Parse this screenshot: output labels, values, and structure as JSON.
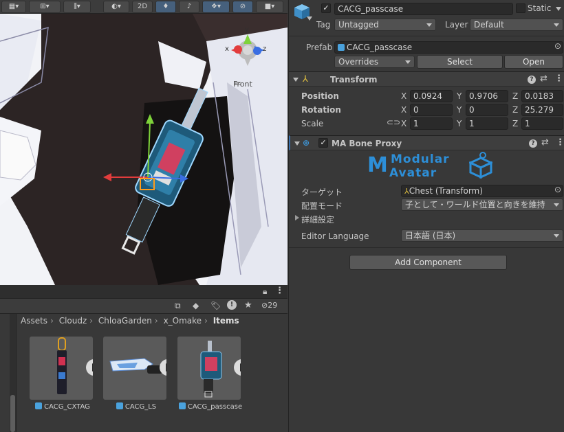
{
  "scene": {
    "toolbar": {
      "mode_2d": "2D"
    },
    "gizmo": {
      "view_label": "Front",
      "axis_y": "y",
      "axis_x": "x",
      "axis_z": "z"
    }
  },
  "project": {
    "visible_count": "29",
    "breadcrumb": [
      "Assets",
      "Cloudz",
      "ChloaGarden",
      "x_Omake"
    ],
    "breadcrumb_current": "Items",
    "assets": [
      {
        "name": "CACG_CXTAG",
        "icon": "prefab-cube-icon"
      },
      {
        "name": "CACG_LS",
        "icon": "prefab-cube-icon"
      },
      {
        "name": "CACG_passcase",
        "icon": "prefab-cube-icon"
      }
    ]
  },
  "inspector": {
    "object_name": "CACG_passcase",
    "active": true,
    "static_label": "Static",
    "tag_label": "Tag",
    "tag_value": "Untagged",
    "layer_label": "Layer",
    "layer_value": "Default",
    "prefab_label": "Prefab",
    "prefab_value": "CACG_passcase",
    "overrides_label": "Overrides",
    "select_label": "Select",
    "open_label": "Open",
    "transform": {
      "title": "Transform",
      "position_label": "Position",
      "rotation_label": "Rotation",
      "scale_label": "Scale",
      "position": {
        "x": "0.0924",
        "y": "0.9706",
        "z": "0.0183"
      },
      "rotation": {
        "x": "0",
        "y": "0",
        "z": "25.279"
      },
      "scale": {
        "x": "1",
        "y": "1",
        "z": "1"
      }
    },
    "bone_proxy": {
      "title": "MA Bone Proxy",
      "logo_line1": "Modular",
      "logo_line2": "Avatar",
      "target_label": "ターゲット",
      "target_value": "Chest (Transform)",
      "placement_label": "配置モード",
      "placement_value": "子として・ワールド位置と向きを維持",
      "advanced_label": "詳細設定",
      "language_label": "Editor Language",
      "language_value": "日本語 (日本)"
    },
    "add_component_label": "Add Component"
  },
  "colors": {
    "accent_blue": "#3a72b0",
    "axis_x": "#e23c3c",
    "axis_y": "#7ed23a",
    "axis_z": "#3a6ee2"
  }
}
